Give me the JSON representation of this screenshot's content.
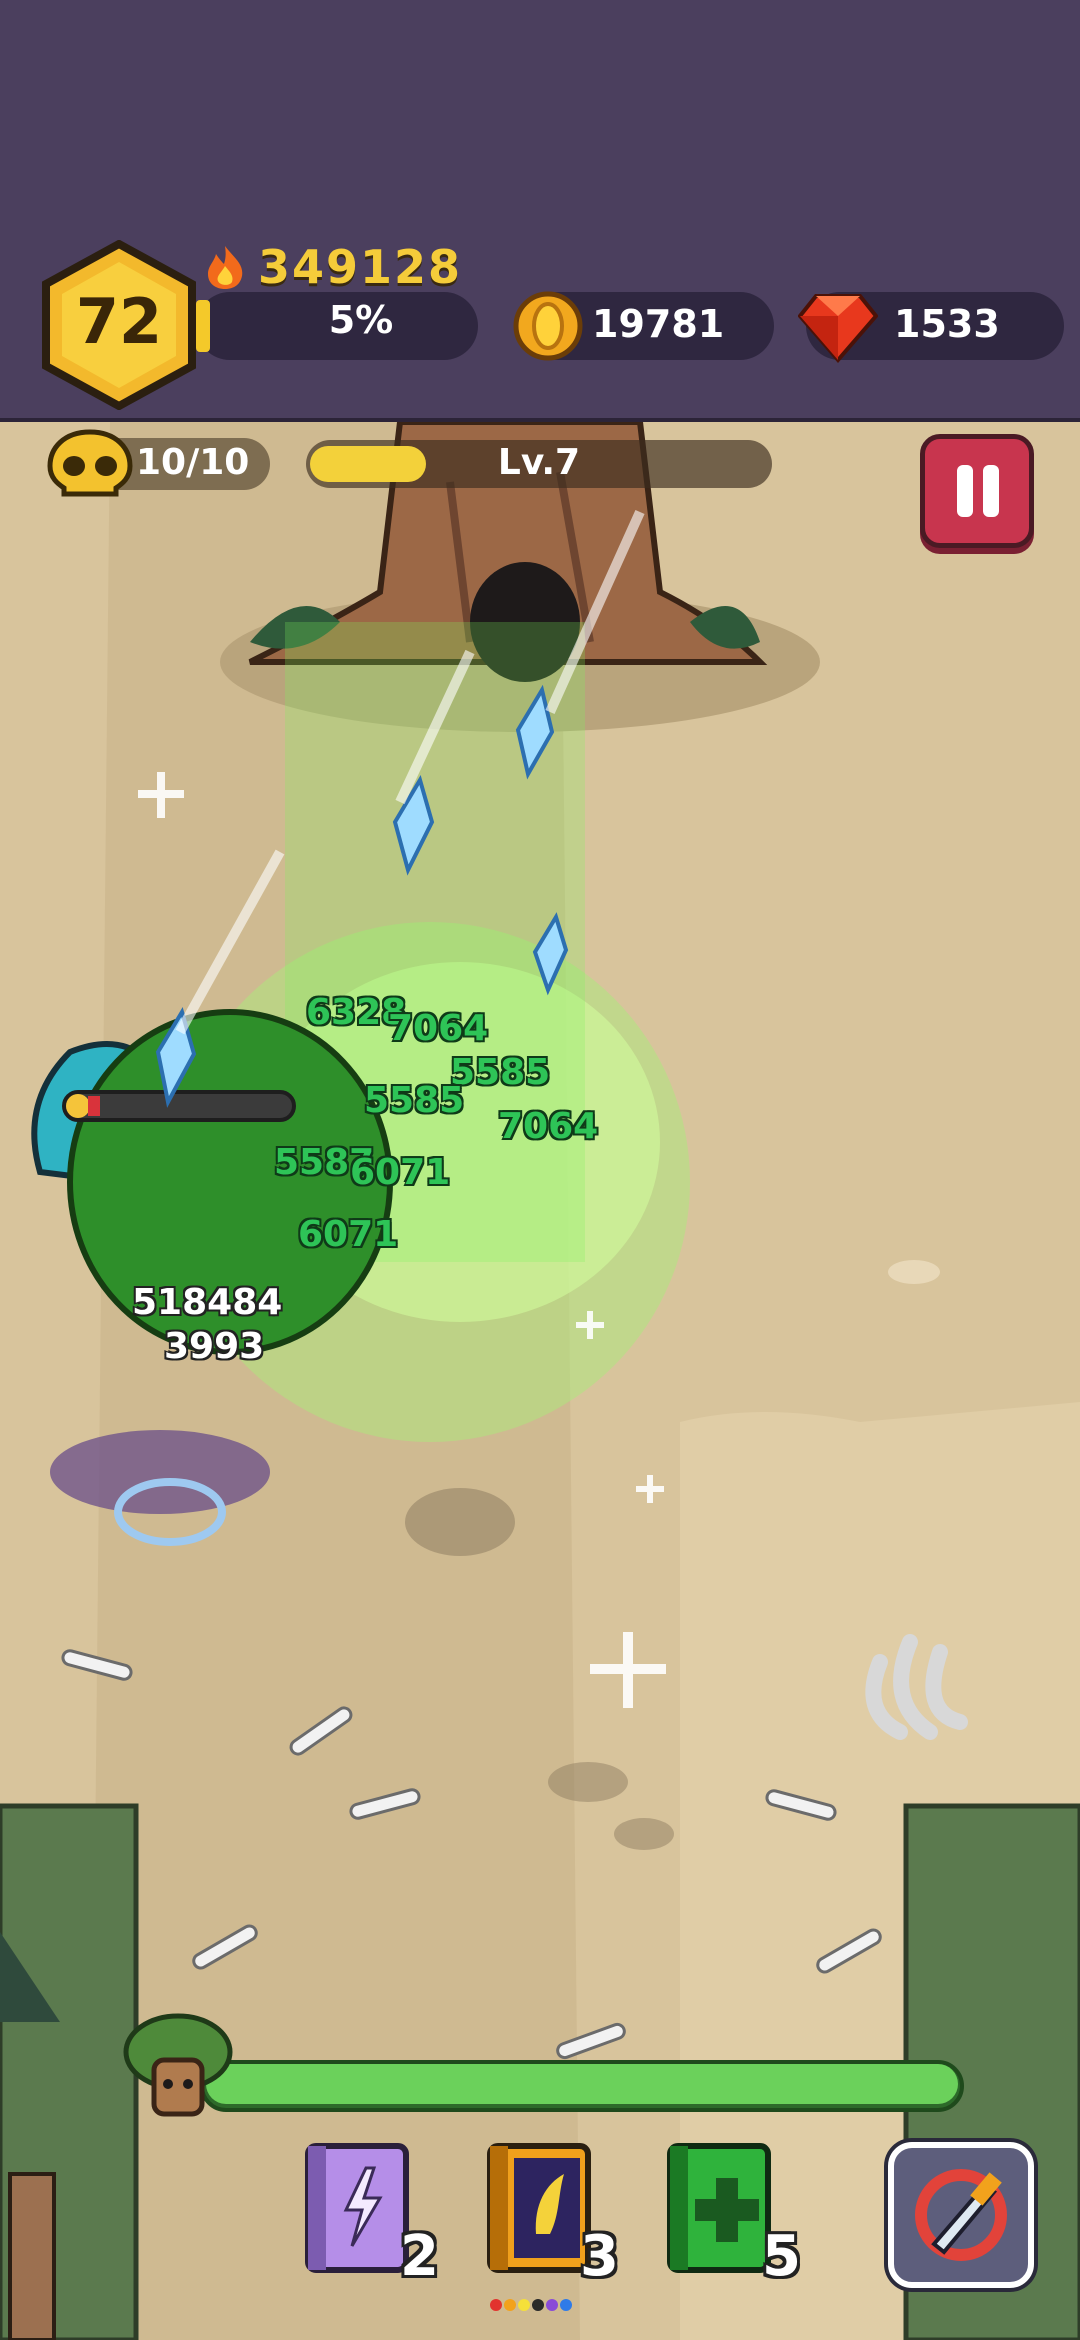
{
  "hud": {
    "level": "72",
    "power": "349128",
    "xp_percent_text": "5%",
    "coins": "19781",
    "gems": "1533"
  },
  "stage": {
    "wave": "10/10",
    "level_label": "Lv.7"
  },
  "damage_numbers": [
    "6328",
    "7064",
    "5585",
    "5585",
    "7064",
    "5587",
    "6071",
    "6071",
    "518484",
    "3993"
  ],
  "skills": [
    {
      "name": "lightning-book",
      "count": "2",
      "color": "#b58ee8"
    },
    {
      "name": "wing-book",
      "count": "3",
      "color": "#f0a01c"
    },
    {
      "name": "heal-book",
      "count": "5",
      "color": "#2fb33c"
    }
  ],
  "colors": {
    "hud_bg": "#4b3f5e",
    "pause": "#c8354e",
    "heal_green": "#6bd15b",
    "gold": "#f5cc3a"
  }
}
